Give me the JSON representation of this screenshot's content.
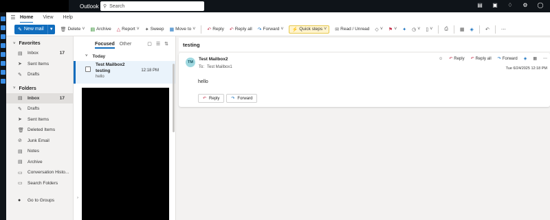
{
  "topbar": {
    "app_title": "Outlook",
    "search_placeholder": "Search",
    "icons": [
      "notes-icon",
      "calendar-icon",
      "bell-icon",
      "gear-icon",
      "help-icon"
    ]
  },
  "menu": {
    "tabs": [
      "Home",
      "View",
      "Help"
    ],
    "active_tab": "Home"
  },
  "toolbar": {
    "new_mail": "New mail",
    "delete": "Delete",
    "archive": "Archive",
    "report": "Report",
    "sweep": "Sweep",
    "move_to": "Move to",
    "reply": "Reply",
    "reply_all": "Reply all",
    "forward": "Forward",
    "quick_steps": "Quick steps",
    "read_unread": "Read / Unread"
  },
  "folders": {
    "favorites_label": "Favorites",
    "favorites": [
      {
        "label": "Inbox",
        "count": "17",
        "icon": "inbox-icon"
      },
      {
        "label": "Sent Items",
        "count": "",
        "icon": "sent-icon"
      },
      {
        "label": "Drafts",
        "count": "",
        "icon": "drafts-icon"
      }
    ],
    "folders_label": "Folders",
    "folders": [
      {
        "label": "Inbox",
        "count": "17",
        "icon": "inbox-icon"
      },
      {
        "label": "Drafts",
        "count": "",
        "icon": "drafts-icon"
      },
      {
        "label": "Sent Items",
        "count": "",
        "icon": "sent-icon"
      },
      {
        "label": "Deleted Items",
        "count": "",
        "icon": "trash-icon"
      },
      {
        "label": "Junk Email",
        "count": "",
        "icon": "junk-icon"
      },
      {
        "label": "Notes",
        "count": "",
        "icon": "notes-icon"
      },
      {
        "label": "Archive",
        "count": "",
        "icon": "archive-icon"
      },
      {
        "label": "Conversation Histo...",
        "count": "",
        "icon": "folder-icon"
      },
      {
        "label": "Search Folders",
        "count": "",
        "icon": "search-folder-icon"
      }
    ],
    "groups_link": "Go to Groups"
  },
  "list": {
    "tabs": [
      "Focused",
      "Other"
    ],
    "active_tab": "Focused",
    "group_label": "Today",
    "messages": [
      {
        "from": "Test Mailbox2",
        "subject": "testing",
        "time": "12:18 PM",
        "preview": "hello"
      }
    ]
  },
  "reading": {
    "subject": "testing",
    "avatar_initials": "TM",
    "sender": "Test Mailbox2",
    "to_label": "To:",
    "to": "Test Mailbox1",
    "date": "Tue 6/24/2025 12:18 PM",
    "body": "hello",
    "actions": {
      "reply": "Reply",
      "reply_all": "Reply all",
      "forward": "Forward"
    },
    "buttons": {
      "reply": "Reply",
      "forward": "Forward"
    }
  },
  "colors": {
    "accent": "#0f6cbd",
    "topbar": "#0f1419",
    "avatar": "#9fd8e0",
    "reply_icon": "#c4314b"
  }
}
